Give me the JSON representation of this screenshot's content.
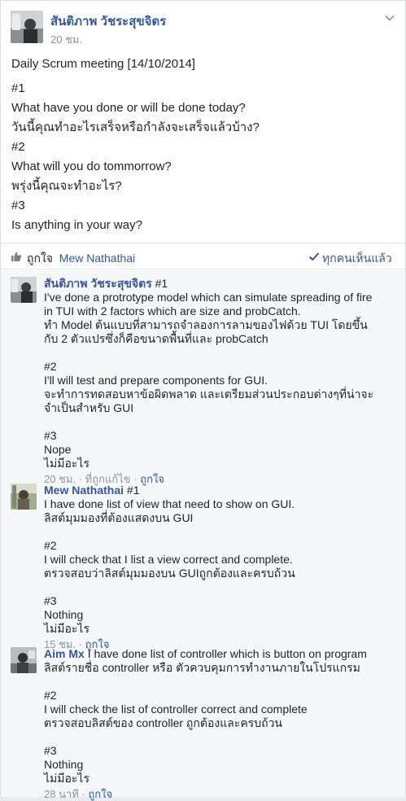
{
  "post": {
    "author": "สันติภาพ วัชระสุขจิตร",
    "time": "20 ชม.",
    "lines": [
      "Daily Scrum meeting [14/10/2014]",
      "#1",
      "What have you done or will be done today?",
      "วันนี้คุณทำอะไรเสร็จหรือกำลังจะเสร็จแล้วบ้าง?",
      "#2",
      "What will you do tommorrow?",
      "พรุ่งนี้คุณจะทำอะไร?",
      "#3",
      "Is anything in your way?"
    ]
  },
  "engagement": {
    "like_label": "ถูกใจ",
    "liker": "Mew Nathathai",
    "seen_label": "ทุกคนเห็นแล้ว"
  },
  "comments": [
    {
      "author": "สันติภาพ วัชระสุขจิตร",
      "first_line": "#1",
      "lines": [
        "I've done a protrotype model which can simulate spreading of fire",
        "in TUI with 2 factors which are size and probCatch.",
        "ทำ Model ต้นแบบที่สามารถจำลองการลามของไฟด้วย TUI โดยขึ้น",
        "กับ 2 ตัวแปรซึ่งก็คือขนาดพื้นที่และ probCatch",
        "#2",
        "I'll will test and prepare components for GUI.",
        "จะทำการทดสอบหาข้อผิดพลาด และเตรียมส่วนประกอบต่างๆที่น่าจะ",
        "จำเป็นสำหรับ GUI",
        "#3",
        "Nope",
        "ไม่มีอะไร"
      ],
      "meta": {
        "time": "20 ชม.",
        "edited": "ที่ถูกแก้ไข",
        "like": "ถูกใจ"
      }
    },
    {
      "author": "Mew Nathathai",
      "first_line": "#1",
      "lines": [
        "I have done list of view that need to show on GUI.",
        "ลิสต์มุมมองที่ต้องแสดงบน GUI",
        "#2",
        "I will check that I list a view correct and complete.",
        "ตรวจสอบว่าลิสต์มุมมองบน GUIถูกต้องและครบถ้วน",
        "#3",
        "Nothing",
        "ไม่มีอะไร"
      ],
      "meta": {
        "time": "15 ชม.",
        "like": "ถูกใจ"
      }
    },
    {
      "author": "Aim Mx",
      "first_line": "I have done list of controller which is button on program",
      "lines": [
        "ลิสต์รายชื่อ controller หรือ ตัวควบคุมการทำงานภายในโปรแกรม",
        "#2",
        "I will check the list of controller correct and complete",
        "ตรวจสอบลิสต์ของ controller ถูกต้องและครบถ้วน",
        "#3",
        "Nothing",
        "ไม่มีอะไร"
      ],
      "meta": {
        "time": "28 นาที",
        "like": "ถูกใจ"
      }
    }
  ],
  "icons": {
    "options": "chevron-down-icon",
    "like": "thumbs-up-icon",
    "seen": "checkmark-icon"
  },
  "colors": {
    "link": "#365899",
    "meta": "#90949c",
    "text": "#1d2129",
    "comments_bg": "#f6f7f9"
  }
}
